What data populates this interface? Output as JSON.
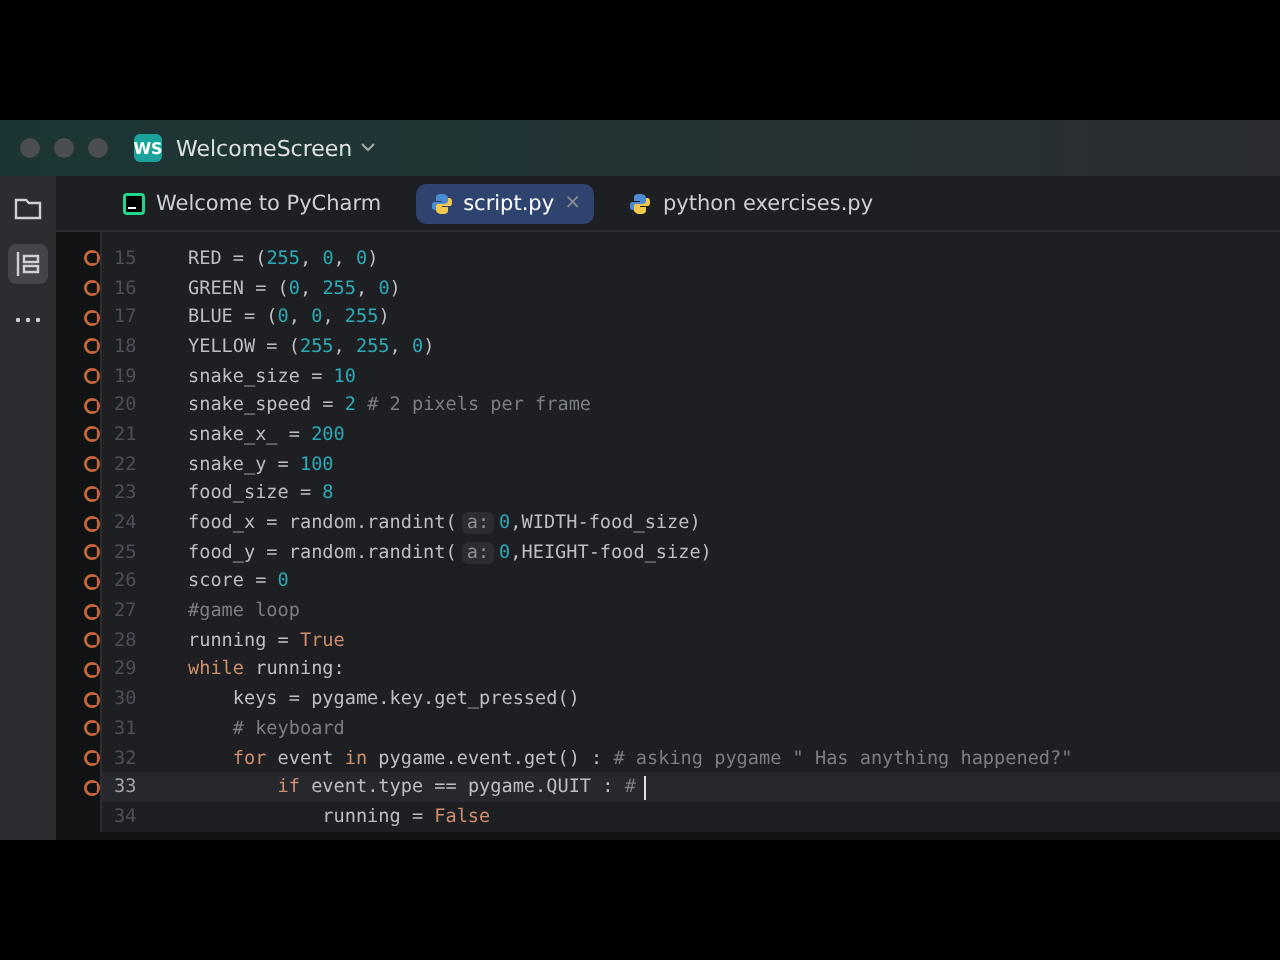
{
  "window": {
    "project_badge": "WS",
    "project_name": "WelcomeScreen"
  },
  "tabs": [
    {
      "label": "Welcome to PyCharm",
      "kind": "welcome",
      "selected": false,
      "closable": false
    },
    {
      "label": "script.py",
      "kind": "python",
      "selected": true,
      "closable": true,
      "close_glyph": "×"
    },
    {
      "label": "python exercises.py",
      "kind": "python",
      "selected": false,
      "closable": false
    }
  ],
  "editor": {
    "lines": [
      {
        "number": "15",
        "marker": true,
        "current": false,
        "tokens": [
          {
            "kind": "plain",
            "text": "RED = ("
          },
          {
            "kind": "number",
            "text": "255"
          },
          {
            "kind": "plain",
            "text": ", "
          },
          {
            "kind": "number",
            "text": "0"
          },
          {
            "kind": "plain",
            "text": ", "
          },
          {
            "kind": "number",
            "text": "0"
          },
          {
            "kind": "plain",
            "text": ")"
          }
        ]
      },
      {
        "number": "16",
        "marker": true,
        "current": false,
        "tokens": [
          {
            "kind": "plain",
            "text": "GREEN = ("
          },
          {
            "kind": "number",
            "text": "0"
          },
          {
            "kind": "plain",
            "text": ", "
          },
          {
            "kind": "number",
            "text": "255"
          },
          {
            "kind": "plain",
            "text": ", "
          },
          {
            "kind": "number",
            "text": "0"
          },
          {
            "kind": "plain",
            "text": ")"
          }
        ]
      },
      {
        "number": "17",
        "marker": true,
        "current": false,
        "tokens": [
          {
            "kind": "plain",
            "text": "BLUE = ("
          },
          {
            "kind": "number",
            "text": "0"
          },
          {
            "kind": "plain",
            "text": ", "
          },
          {
            "kind": "number",
            "text": "0"
          },
          {
            "kind": "plain",
            "text": ", "
          },
          {
            "kind": "number",
            "text": "255"
          },
          {
            "kind": "plain",
            "text": ")"
          }
        ]
      },
      {
        "number": "18",
        "marker": true,
        "current": false,
        "tokens": [
          {
            "kind": "plain",
            "text": "YELLOW = ("
          },
          {
            "kind": "number",
            "text": "255"
          },
          {
            "kind": "plain",
            "text": ", "
          },
          {
            "kind": "number",
            "text": "255"
          },
          {
            "kind": "plain",
            "text": ", "
          },
          {
            "kind": "number",
            "text": "0"
          },
          {
            "kind": "plain",
            "text": ")"
          }
        ]
      },
      {
        "number": "19",
        "marker": true,
        "current": false,
        "tokens": [
          {
            "kind": "plain",
            "text": "snake_size = "
          },
          {
            "kind": "number",
            "text": "10"
          }
        ]
      },
      {
        "number": "20",
        "marker": true,
        "current": false,
        "tokens": [
          {
            "kind": "plain",
            "text": "snake_speed = "
          },
          {
            "kind": "number",
            "text": "2"
          },
          {
            "kind": "comment",
            "text": " # 2 pixels per frame"
          }
        ]
      },
      {
        "number": "21",
        "marker": true,
        "current": false,
        "tokens": [
          {
            "kind": "plain",
            "text": "snake_x_ = "
          },
          {
            "kind": "number",
            "text": "200"
          }
        ]
      },
      {
        "number": "22",
        "marker": true,
        "current": false,
        "tokens": [
          {
            "kind": "plain",
            "text": "snake_y = "
          },
          {
            "kind": "number",
            "text": "100"
          }
        ]
      },
      {
        "number": "23",
        "marker": true,
        "current": false,
        "tokens": [
          {
            "kind": "plain",
            "text": "food_size = "
          },
          {
            "kind": "number",
            "text": "8"
          }
        ]
      },
      {
        "number": "24",
        "marker": true,
        "current": false,
        "tokens": [
          {
            "kind": "plain",
            "text": "food_x = random.randint("
          },
          {
            "kind": "hint",
            "text": "a:"
          },
          {
            "kind": "number",
            "text": "0"
          },
          {
            "kind": "plain",
            "text": ",WIDTH-food_size)"
          }
        ]
      },
      {
        "number": "25",
        "marker": true,
        "current": false,
        "tokens": [
          {
            "kind": "plain",
            "text": "food_y = random.randint("
          },
          {
            "kind": "hint",
            "text": "a:"
          },
          {
            "kind": "number",
            "text": "0"
          },
          {
            "kind": "plain",
            "text": ",HEIGHT-food_size)"
          }
        ]
      },
      {
        "number": "26",
        "marker": true,
        "current": false,
        "tokens": [
          {
            "kind": "plain",
            "text": "score = "
          },
          {
            "kind": "number",
            "text": "0"
          }
        ]
      },
      {
        "number": "27",
        "marker": true,
        "current": false,
        "tokens": [
          {
            "kind": "comment",
            "text": "#game loop"
          }
        ]
      },
      {
        "number": "28",
        "marker": true,
        "current": false,
        "tokens": [
          {
            "kind": "plain",
            "text": "running = "
          },
          {
            "kind": "keyword",
            "text": "True"
          }
        ]
      },
      {
        "number": "29",
        "marker": true,
        "current": false,
        "tokens": [
          {
            "kind": "keyword",
            "text": "while"
          },
          {
            "kind": "plain",
            "text": " running:"
          }
        ]
      },
      {
        "number": "30",
        "marker": true,
        "current": false,
        "tokens": [
          {
            "kind": "plain",
            "text": "    keys = pygame.key.get_pressed()"
          }
        ]
      },
      {
        "number": "31",
        "marker": true,
        "current": false,
        "tokens": [
          {
            "kind": "comment",
            "text": "    # keyboard"
          }
        ]
      },
      {
        "number": "32",
        "marker": true,
        "current": false,
        "tokens": [
          {
            "kind": "keyword",
            "text": "    for"
          },
          {
            "kind": "plain",
            "text": " event "
          },
          {
            "kind": "keyword",
            "text": "in"
          },
          {
            "kind": "plain",
            "text": " pygame.event.get() : "
          },
          {
            "kind": "comment",
            "text": "# asking pygame \" Has anything happened?\""
          }
        ]
      },
      {
        "number": "33",
        "marker": true,
        "current": true,
        "tokens": [
          {
            "kind": "keyword",
            "text": "        if"
          },
          {
            "kind": "plain",
            "text": " event.type == pygame.QUIT : "
          },
          {
            "kind": "comment",
            "text": "#"
          }
        ]
      },
      {
        "number": "34",
        "marker": false,
        "current": false,
        "tokens": [
          {
            "kind": "plain",
            "text": "            running = "
          },
          {
            "kind": "keyword",
            "text": "False"
          }
        ]
      }
    ]
  }
}
